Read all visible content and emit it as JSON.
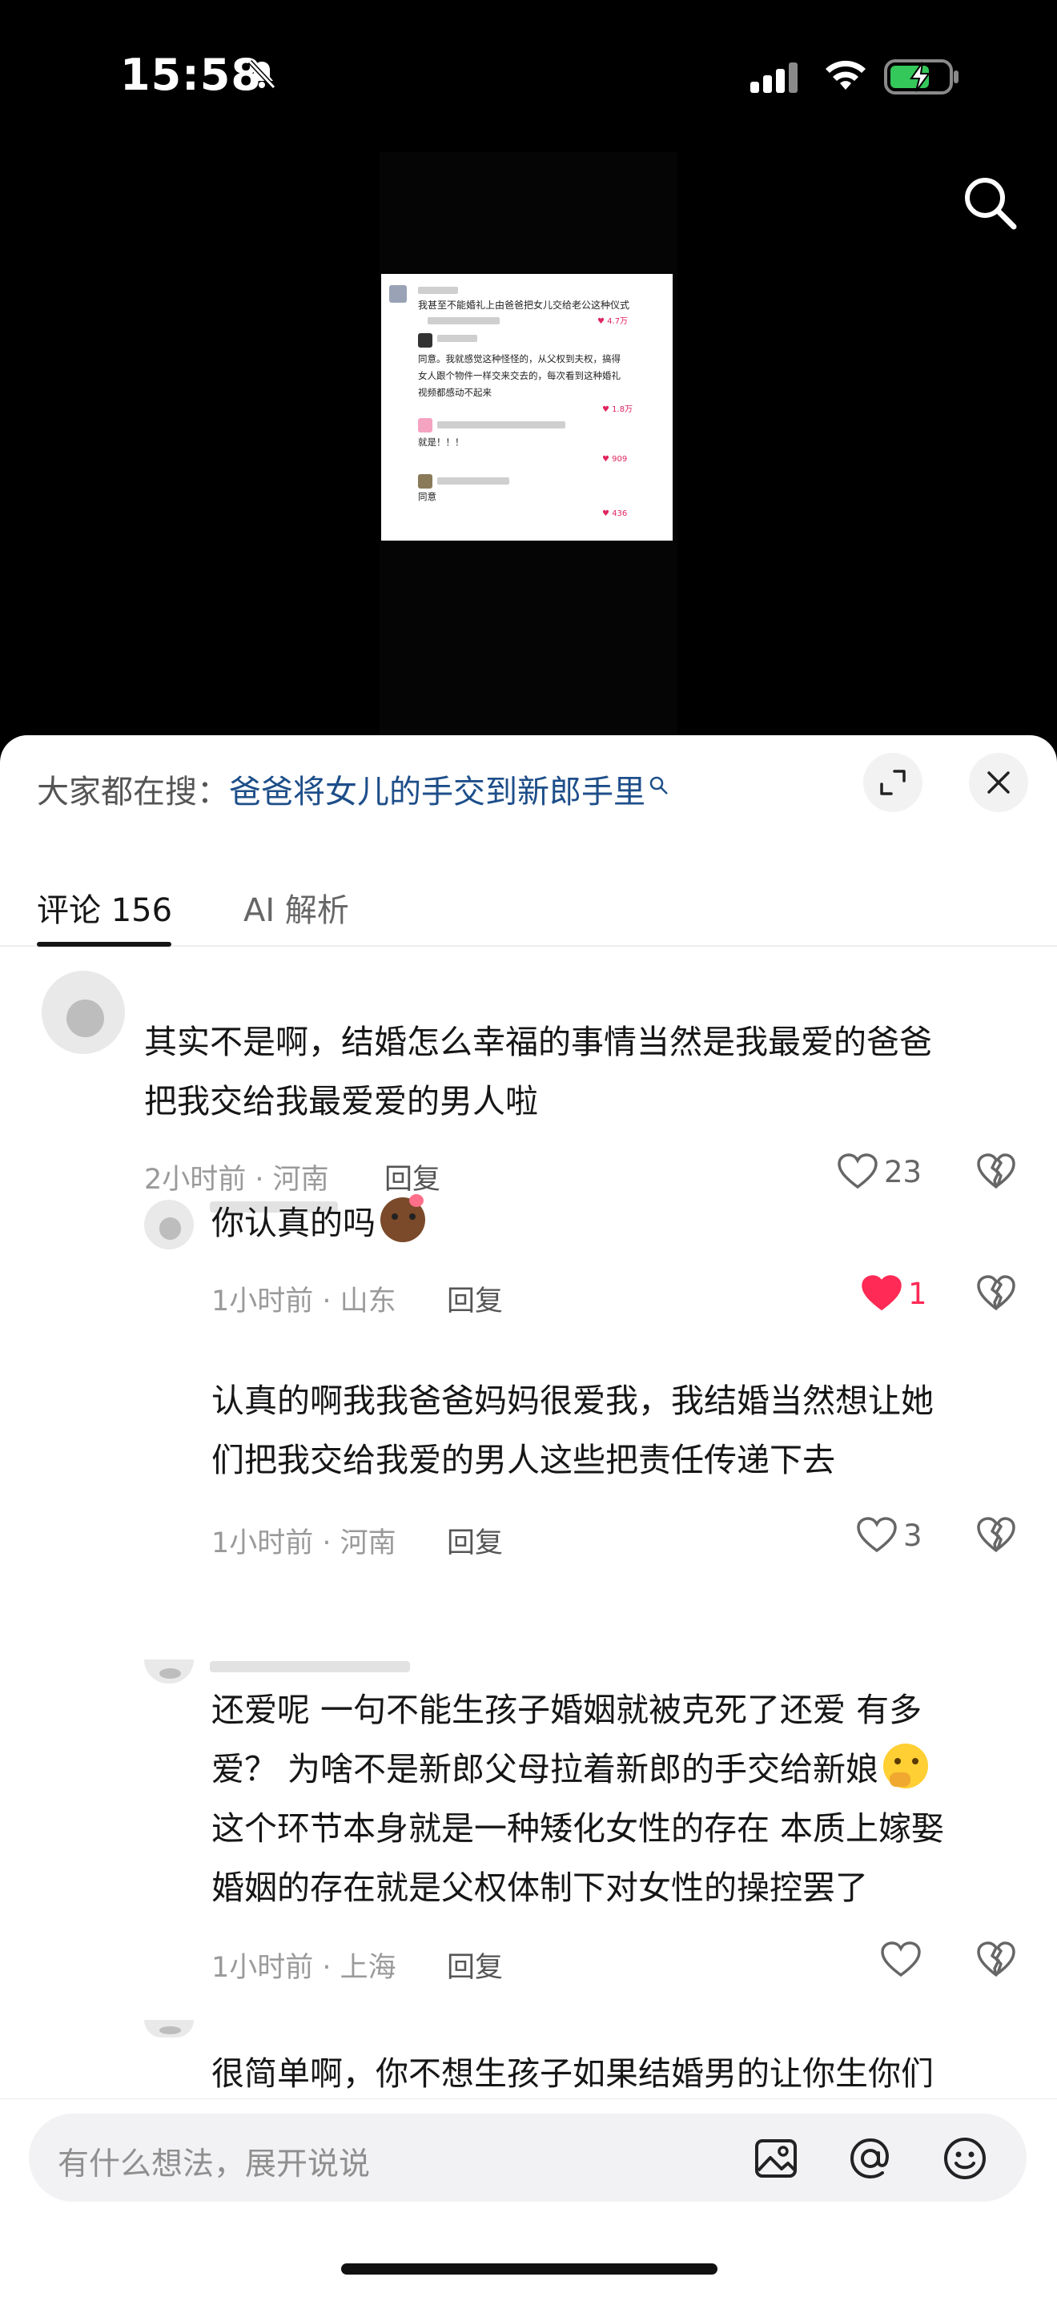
{
  "status_bar": {
    "time": "15:58"
  },
  "video": {
    "thumbnail": {
      "title": "我甚至不能婚礼上由爸爸把女儿交给老公这种仪式",
      "lines": [
        {
          "text": "同意。我就感觉这种怪怪的，从父权到夫权，搞得",
          "row": 1
        },
        {
          "text": "女人跟个物件一样交来交去的，每次看到这种婚礼",
          "row": 2
        },
        {
          "text": "视频都感动不起来",
          "row": 3
        },
        {
          "text": "就是！！！",
          "row": 4
        },
        {
          "text": "同意",
          "row": 5
        }
      ],
      "likes": [
        "4.7万",
        "1.8万",
        "909",
        "436"
      ]
    }
  },
  "sheet": {
    "hot_search_prefix": "大家都在搜：",
    "hot_search_query": "爸爸将女儿的手交到新郎手里",
    "tabs": [
      {
        "label": "评论 156",
        "active": true
      },
      {
        "label": "AI 解析",
        "active": false
      }
    ]
  },
  "comments": [
    {
      "lines": [
        "其实不是啊，结婚怎么幸福的事情当然是我最爱的爸爸",
        "把我交给我最爱爱的男人啦"
      ],
      "meta": "2小时前 · 河南",
      "reply": "回复",
      "likes": "23",
      "liked": false
    },
    {
      "lines": [
        "你认真的吗"
      ],
      "emoji": "shy-face",
      "meta": "1小时前 · 山东",
      "reply": "回复",
      "likes": "1",
      "liked": true
    },
    {
      "lines": [
        "认真的啊我我爸爸妈妈很爱我，我结婚当然想让她",
        "们把我交给我爱的男人这些把责任传递下去"
      ],
      "meta": "1小时前 · 河南",
      "reply": "回复",
      "likes": "3",
      "liked": false
    },
    {
      "lines": [
        "还爱呢 一句不能生孩子婚姻就被克死了还爱 有多",
        "爱？ 为啥不是新郎父母拉着新郎的手交给新娘",
        "这个环节本身就是一种矮化女性的存在 本质上嫁娶",
        "婚姻的存在就是父权体制下对女性的操控罢了"
      ],
      "emoji": "thinking-face",
      "meta": "1小时前 · 上海",
      "reply": "回复",
      "likes": "",
      "liked": false
    },
    {
      "lines": [
        "很简单啊，你不想生孩子如果结婚男的让你生你们"
      ]
    }
  ],
  "input": {
    "placeholder": "有什么想法，展开说说"
  },
  "icons": [
    "bell-mute-icon",
    "signal-icon",
    "wifi-icon",
    "battery-charging-icon",
    "search-icon",
    "expand-icon",
    "close-icon",
    "heart-icon",
    "dislike-icon",
    "image-icon",
    "at-icon",
    "emoji-icon"
  ],
  "colors": {
    "accent_blue": "#1d4e89",
    "like_red": "#ff2a55"
  }
}
